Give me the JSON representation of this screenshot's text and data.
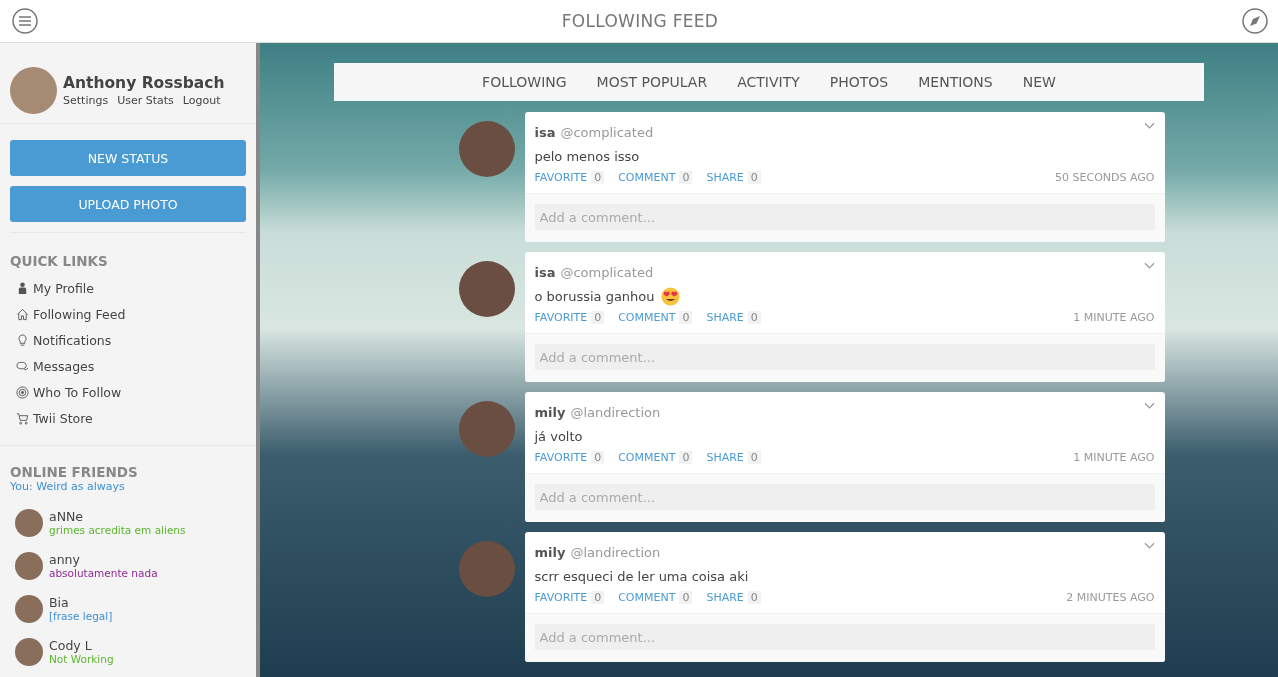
{
  "header": {
    "title": "FOLLOWING FEED"
  },
  "profile": {
    "name": "Anthony Rossbach",
    "links": [
      "Settings",
      "User Stats",
      "Logout"
    ]
  },
  "buttons": [
    "NEW STATUS",
    "UPLOAD PHOTO"
  ],
  "quick_links": {
    "title": "QUICK LINKS",
    "items": [
      {
        "label": "My Profile",
        "kind": "person"
      },
      {
        "label": "Following Feed",
        "kind": "home"
      },
      {
        "label": "Notifications",
        "kind": "bulb"
      },
      {
        "label": "Messages",
        "kind": "chat"
      },
      {
        "label": "Who To Follow",
        "kind": "target"
      },
      {
        "label": "Twii Store",
        "kind": "cart"
      }
    ]
  },
  "online_friends": {
    "title": "ONLINE FRIENDS",
    "you": "You: Weird as always",
    "friends": [
      {
        "name": "aNNe",
        "status": "grimes acredita em aliens",
        "color": "#5cb531"
      },
      {
        "name": "anny",
        "status": "absolutamente nada",
        "color": "#8e2c96"
      },
      {
        "name": "Bia",
        "status": "[frase legal]",
        "color": "#3f8fd2"
      },
      {
        "name": "Cody L",
        "status": "Not Working",
        "color": "#5cb531"
      }
    ]
  },
  "tabs": [
    {
      "label": "FOLLOWING",
      "selected": false
    },
    {
      "label": "MOST POPULAR",
      "selected": false
    },
    {
      "label": "ACTIVITY",
      "selected": false
    },
    {
      "label": "PHOTOS",
      "selected": false
    },
    {
      "label": "MENTIONS",
      "selected": false
    },
    {
      "label": "NEW",
      "selected": false
    }
  ],
  "posts": [
    {
      "name": "isa",
      "handle": "@complicated",
      "text": "pelo menos isso",
      "emoji": false,
      "actions": [
        {
          "label": "FAVORITE",
          "count": "0"
        },
        {
          "label": "COMMENT",
          "count": "0"
        },
        {
          "label": "SHARE",
          "count": "0"
        }
      ],
      "time": "50 SECONDS AGO",
      "placeholder": "Add a comment..."
    },
    {
      "name": "isa",
      "handle": "@complicated",
      "text": "o borussia ganhou",
      "emoji": true,
      "actions": [
        {
          "label": "FAVORITE",
          "count": "0"
        },
        {
          "label": "COMMENT",
          "count": "0"
        },
        {
          "label": "SHARE",
          "count": "0"
        }
      ],
      "time": "1 MINUTE AGO",
      "placeholder": "Add a comment..."
    },
    {
      "name": "mily",
      "handle": "@landirection",
      "text": "já volto",
      "emoji": false,
      "actions": [
        {
          "label": "FAVORITE",
          "count": "0"
        },
        {
          "label": "COMMENT",
          "count": "0"
        },
        {
          "label": "SHARE",
          "count": "0"
        }
      ],
      "time": "1 MINUTE AGO",
      "placeholder": "Add a comment..."
    },
    {
      "name": "mily",
      "handle": "@landirection",
      "text": "scrr esqueci de ler uma coisa aki",
      "emoji": false,
      "actions": [
        {
          "label": "FAVORITE",
          "count": "0"
        },
        {
          "label": "COMMENT",
          "count": "0"
        },
        {
          "label": "SHARE",
          "count": "0"
        }
      ],
      "time": "2 MINUTES AGO",
      "placeholder": "Add a comment..."
    }
  ]
}
